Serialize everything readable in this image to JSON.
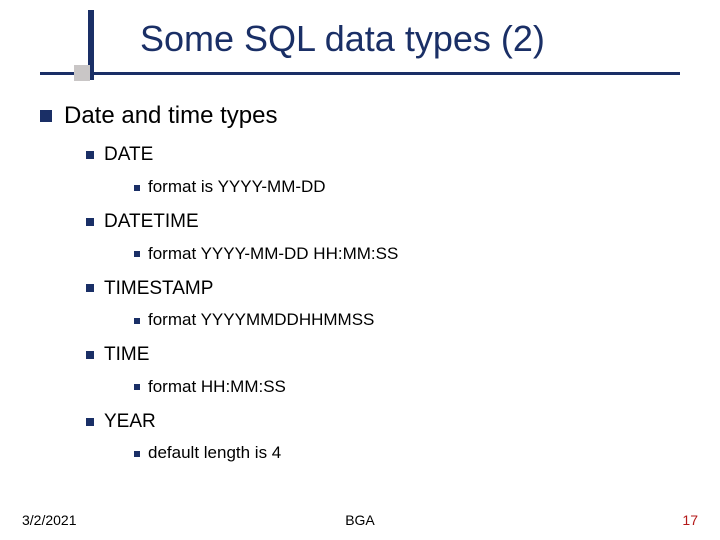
{
  "title": "Some SQL data types (2)",
  "heading": "Date and time types",
  "types": [
    {
      "name": "DATE",
      "detail": "format is YYYY-MM-DD"
    },
    {
      "name": "DATETIME",
      "detail": "format YYYY-MM-DD HH:MM:SS"
    },
    {
      "name": "TIMESTAMP",
      "detail": "format YYYYMMDDHHMMSS"
    },
    {
      "name": "TIME",
      "detail": "format HH:MM:SS"
    },
    {
      "name": "YEAR",
      "detail": "default length is 4"
    }
  ],
  "footer": {
    "date": "3/2/2021",
    "center": "BGA",
    "page": "17"
  }
}
